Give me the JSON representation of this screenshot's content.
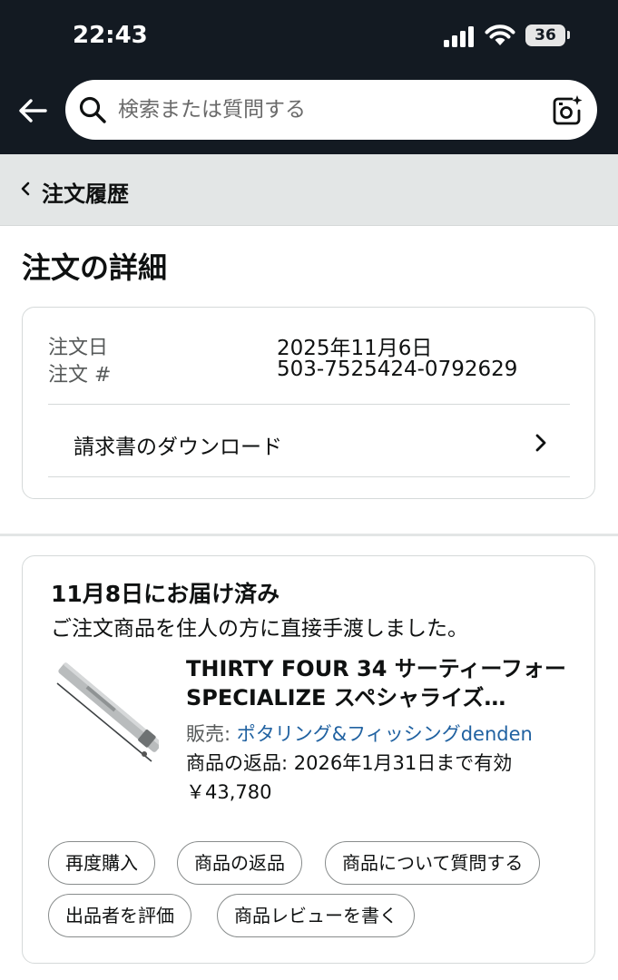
{
  "status_bar": {
    "time": "22:43",
    "battery": "36"
  },
  "search": {
    "placeholder": "検索または質問する"
  },
  "breadcrumb": {
    "label": "注文履歴"
  },
  "page": {
    "title": "注文の詳細"
  },
  "order_info": {
    "date_label": "注文日",
    "date_value": "2025年11月6日",
    "number_label": "注文 #",
    "number_value": "503-7525424-0792629",
    "invoice_label": "請求書のダウンロード"
  },
  "shipment": {
    "status": "11月8日にお届け済み",
    "note": "ご注文商品を住人の方に直接手渡しました。",
    "product": {
      "title": "THIRTY FOUR 34 サーティーフォー SPECIALIZE スペシャライズ…",
      "seller_prefix": "販売: ",
      "seller_name": "ポタリング&フィッシングdenden",
      "return_policy": "商品の返品: 2026年1月31日まで有効",
      "price": "￥43,780"
    },
    "actions": [
      "再度購入",
      "商品の返品",
      "商品について質問する",
      "出品者を評価",
      "商品レビューを書く"
    ]
  },
  "colors": {
    "header_bg": "#131a22",
    "link": "#2162a1",
    "crumb_bg": "#e3e6e6"
  },
  "icons": [
    "back-arrow-icon",
    "search-icon",
    "camera-icon",
    "chevron-left-icon",
    "chevron-right-icon",
    "signal-icon",
    "wifi-icon",
    "battery-icon"
  ]
}
